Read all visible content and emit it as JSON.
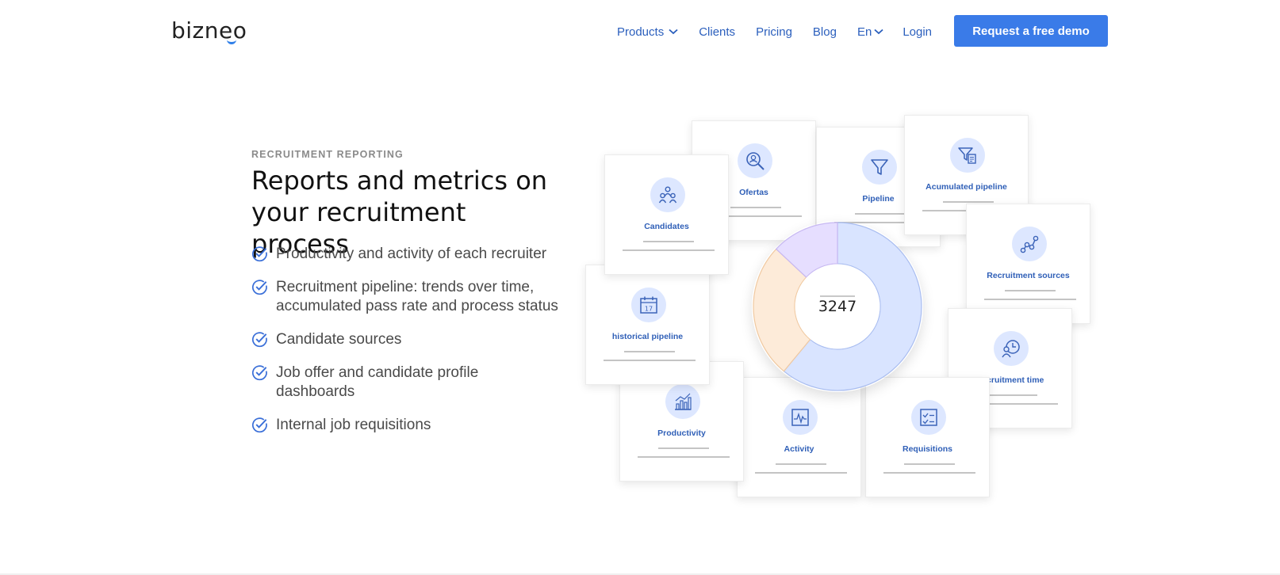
{
  "header": {
    "logo_text": "bizneo",
    "nav": [
      {
        "label": "Products",
        "dropdown": true
      },
      {
        "label": "Clients",
        "dropdown": false
      },
      {
        "label": "Pricing",
        "dropdown": false
      },
      {
        "label": "Blog",
        "dropdown": false
      },
      {
        "label": "En",
        "dropdown": true
      },
      {
        "label": "Login",
        "dropdown": false
      }
    ],
    "cta_label": "Request a free demo"
  },
  "hero": {
    "eyebrow": "RECRUITMENT REPORTING",
    "title": "Reports and metrics on your recruitment process",
    "features": [
      "Productivity and activity of each recruiter",
      "Recruitment pipeline: trends over time, accumulated pass rate and process status",
      "Candidate sources",
      "Job offer and candidate profile dashboards",
      "Internal job requisitions"
    ]
  },
  "illustration": {
    "cards": [
      {
        "label": "Ofertas",
        "icon": "search-user-icon"
      },
      {
        "label": "Pipeline",
        "icon": "funnel-icon"
      },
      {
        "label": "Acumulated pipeline",
        "icon": "funnel-document-icon"
      },
      {
        "label": "Candidates",
        "icon": "people-icon"
      },
      {
        "label": "Recruitment sources",
        "icon": "network-icon"
      },
      {
        "label": "historical pipeline",
        "icon": "calendar-icon"
      },
      {
        "label": "Recruitment time",
        "icon": "clock-user-icon"
      },
      {
        "label": "Productivity",
        "icon": "bar-chart-icon"
      },
      {
        "label": "Activity",
        "icon": "pulse-chart-icon"
      },
      {
        "label": "Requisitions",
        "icon": "checklist-icon"
      }
    ],
    "calendar_day": "17",
    "donut": {
      "value": "3247",
      "segments": [
        {
          "fraction": 0.61,
          "color": "#d9e4ff",
          "stroke": "#a9bdf0"
        },
        {
          "fraction": 0.26,
          "color": "#fdebd9",
          "stroke": "#f0c9a1"
        },
        {
          "fraction": 0.13,
          "color": "#e6deff",
          "stroke": "#c7b8f2"
        }
      ]
    }
  },
  "colors": {
    "accent": "#3a7be8",
    "nav_text": "#2b5fbd",
    "icon_bg": "#dde7ff"
  }
}
